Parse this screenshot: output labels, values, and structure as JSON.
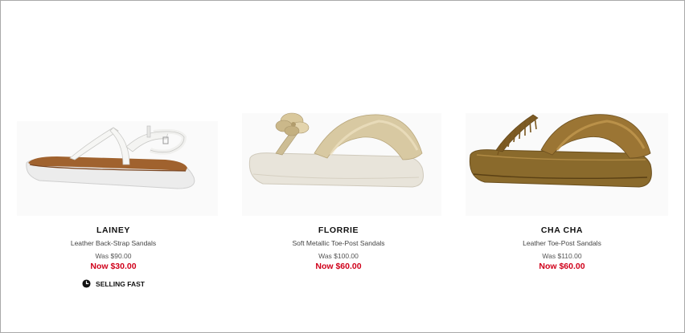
{
  "products": [
    {
      "name": "LAINEY",
      "description": "Leather Back-Strap Sandals",
      "was_price": "Was $90.00",
      "now_price": "Now $30.00",
      "badge": "SELLING FAST",
      "image_icon": "white-back-strap-sandal-image"
    },
    {
      "name": "FLORRIE",
      "description": "Soft Metallic Toe-Post Sandals",
      "was_price": "Was $100.00",
      "now_price": "Now $60.00",
      "image_icon": "metallic-flower-toe-post-sandal-image"
    },
    {
      "name": "CHA CHA",
      "description": "Leather Toe-Post Sandals",
      "was_price": "Was $110.00",
      "now_price": "Now $60.00",
      "image_icon": "bronze-fringe-toe-post-sandal-image"
    }
  ],
  "colors": {
    "sale_price": "#d0021b",
    "text": "#111111",
    "border": "#a9a9a9"
  },
  "badge_icon": "clock-icon"
}
